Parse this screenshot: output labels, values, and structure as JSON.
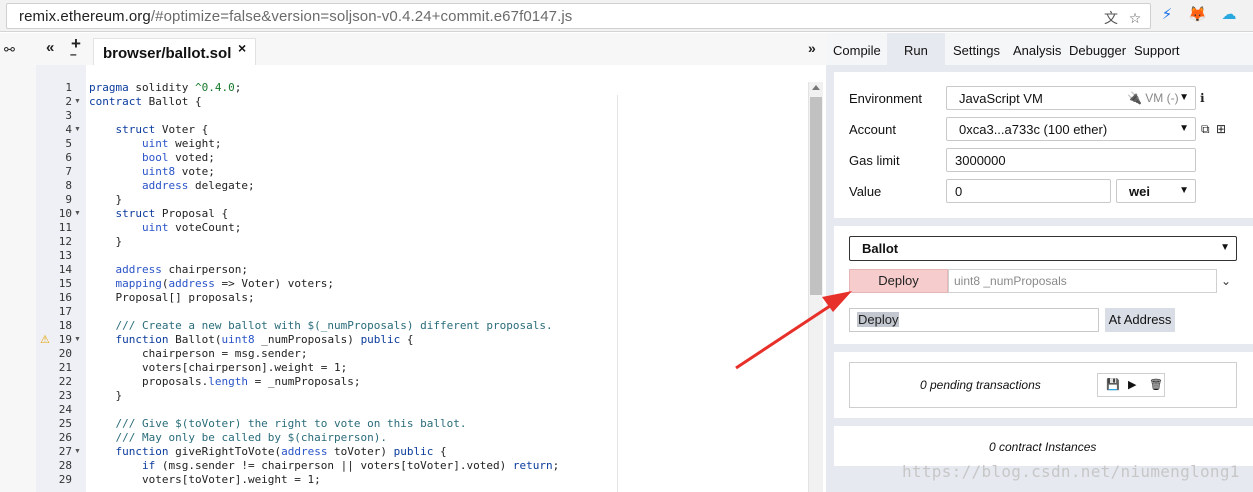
{
  "browser": {
    "url_host": "remix.ethereum.org",
    "url_rest": "/#optimize=false&version=soljson-v0.4.24+commit.e67f0147.js"
  },
  "editor": {
    "file_tab": "browser/ballot.sol",
    "close_glyph": "×",
    "plus_glyph": "+",
    "collapse_glyph": "«",
    "expand_glyph": "»",
    "line_numbers": [
      "1",
      "2",
      "3",
      "4",
      "5",
      "6",
      "7",
      "8",
      "9",
      "10",
      "11",
      "12",
      "13",
      "14",
      "15",
      "16",
      "17",
      "18",
      "19",
      "20",
      "21",
      "22",
      "23",
      "24",
      "25",
      "26",
      "27",
      "28",
      "29"
    ],
    "code_lines": [
      "pragma solidity ^0.4.0;",
      "contract Ballot {",
      "",
      "    struct Voter {",
      "        uint weight;",
      "        bool voted;",
      "        uint8 vote;",
      "        address delegate;",
      "    }",
      "    struct Proposal {",
      "        uint voteCount;",
      "    }",
      "",
      "    address chairperson;",
      "    mapping(address => Voter) voters;",
      "    Proposal[] proposals;",
      "",
      "    /// Create a new ballot with $(_numProposals) different proposals.",
      "    function Ballot(uint8 _numProposals) public {",
      "        chairperson = msg.sender;",
      "        voters[chairperson].weight = 1;",
      "        proposals.length = _numProposals;",
      "    }",
      "",
      "    /// Give $(toVoter) the right to vote on this ballot.",
      "    /// May only be called by $(chairperson).",
      "    function giveRightToVote(address toVoter) public {",
      "        if (msg.sender != chairperson || voters[toVoter].voted) return;",
      "        voters[toVoter].weight = 1;"
    ]
  },
  "tabs": {
    "compile": "Compile",
    "run": "Run",
    "settings": "Settings",
    "analysis": "Analysis",
    "debugger": "Debugger",
    "support": "Support"
  },
  "run": {
    "environment_label": "Environment",
    "environment_value": "JavaScript VM",
    "vm_badge": "VM (-)",
    "account_label": "Account",
    "account_value": "0xca3...a733c (100 ether)",
    "gas_limit_label": "Gas limit",
    "gas_limit_value": "3000000",
    "value_label": "Value",
    "value_value": "0",
    "value_unit": "wei",
    "contract_select": "Ballot",
    "deploy_button": "Deploy",
    "deploy_args_placeholder": "uint8 _numProposals",
    "at_address_input": "Deploy",
    "at_address_button": "At Address",
    "pending_transactions": "0 pending transactions",
    "contract_instances": "0 contract Instances"
  },
  "watermark": "https://blog.csdn.net/niumenglong1",
  "colors": {
    "deploy_bg": "#f6cccc",
    "arrow": "#e8302a",
    "panel_bg": "#e6e9f0"
  }
}
